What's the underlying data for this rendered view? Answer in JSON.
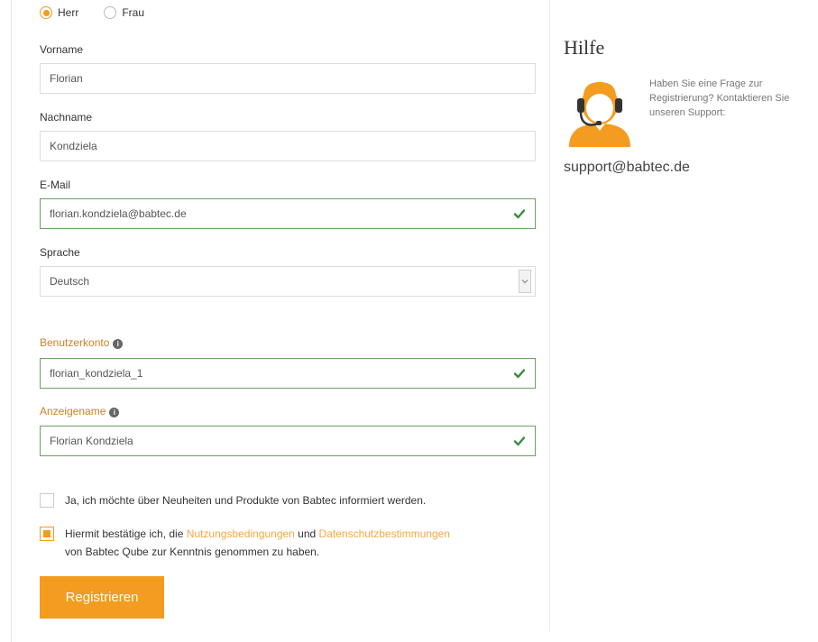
{
  "gender": {
    "options": [
      {
        "label": "Herr",
        "checked": true
      },
      {
        "label": "Frau",
        "checked": false
      }
    ]
  },
  "fields": {
    "vorname": {
      "label": "Vorname",
      "value": "Florian"
    },
    "nachname": {
      "label": "Nachname",
      "value": "Kondziela"
    },
    "email": {
      "label": "E-Mail",
      "value": "florian.kondziela@babtec.de",
      "valid": true
    },
    "sprache": {
      "label": "Sprache",
      "value": "Deutsch"
    },
    "benutzerkonto": {
      "label": "Benutzerkonto",
      "value": "florian_kondziela_1",
      "valid": true
    },
    "anzeigename": {
      "label": "Anzeigename",
      "value": "Florian Kondziela",
      "valid": true
    }
  },
  "consents": {
    "newsletter": {
      "text": "Ja, ich möchte über Neuheiten und Produkte von Babtec informiert werden.",
      "checked": false
    },
    "terms": {
      "text_before": "Hiermit bestätige ich, die ",
      "link1": "Nutzungsbedingungen",
      "text_middle": " und ",
      "link2": "Datenschutzbestimmungen",
      "text_after": "von Babtec Qube zur Kenntnis genommen zu haben.",
      "checked": true
    }
  },
  "submit_label": "Registrieren",
  "help": {
    "title": "Hilfe",
    "text": "Haben Sie eine Frage zur Registrierung? Kontaktieren Sie unseren Support:",
    "email": "support@babtec.de",
    "icon": "support-agent-icon"
  },
  "colors": {
    "accent": "#f39c1f",
    "valid_border": "#6aa364",
    "valid_check": "#3c8a3c"
  }
}
